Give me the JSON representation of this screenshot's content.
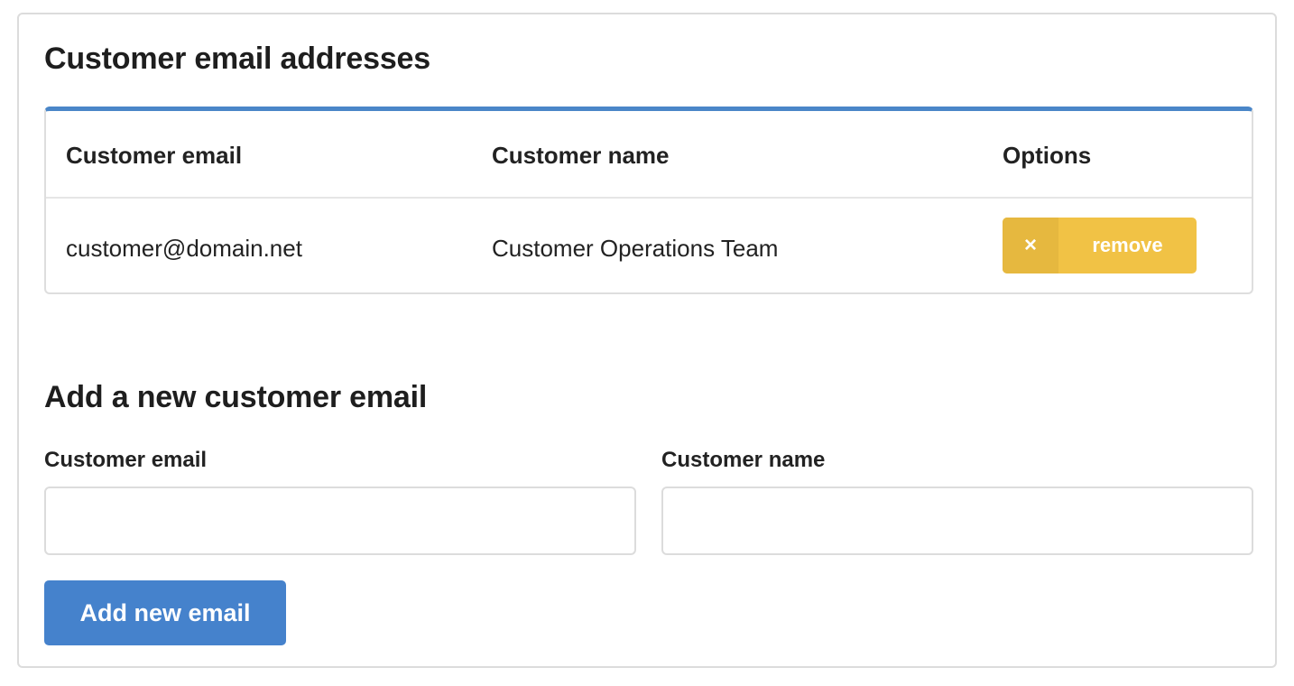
{
  "emails_section": {
    "title": "Customer email addresses",
    "columns": {
      "email": "Customer email",
      "name": "Customer name",
      "options": "Options"
    },
    "rows": [
      {
        "email": "customer@domain.net",
        "name": "Customer Operations Team",
        "remove_icon": "×",
        "remove_label": "remove"
      }
    ]
  },
  "add_section": {
    "title": "Add a new customer email",
    "email_label": "Customer email",
    "email_value": "",
    "name_label": "Customer name",
    "name_value": "",
    "submit_label": "Add new email"
  },
  "colors": {
    "accent": "#4582cc",
    "table_top_border": "#4a86c8",
    "remove_button": "#f1c245",
    "remove_icon_bg": "#e6b83f"
  },
  "icons": {
    "remove": "close-icon"
  }
}
